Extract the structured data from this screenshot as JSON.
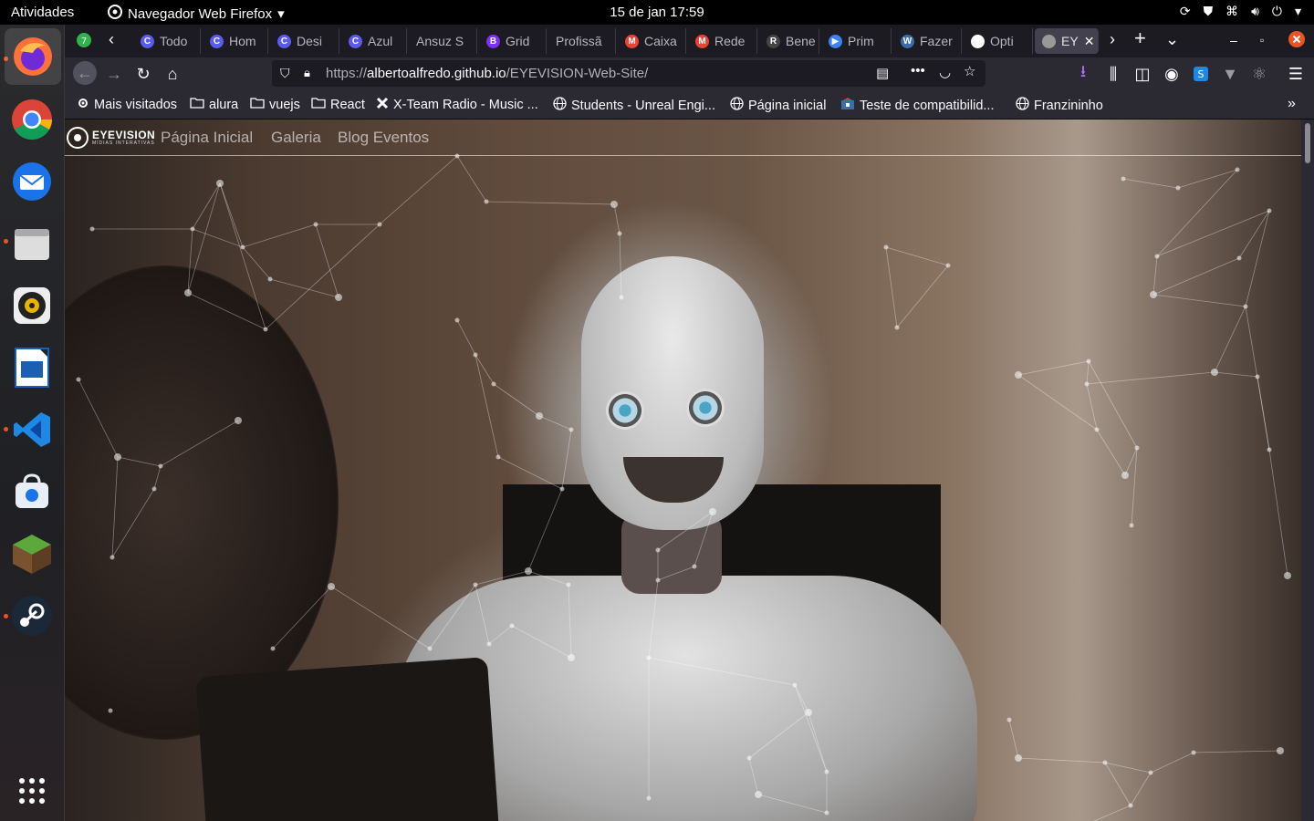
{
  "topbar": {
    "activities": "Atividades",
    "app_name": "Navegador Web Firefox",
    "clock": "15 de jan  17:59"
  },
  "dock": {
    "items": [
      "firefox-icon",
      "chrome-icon",
      "thunderbird-icon",
      "files-icon",
      "rhythmbox-icon",
      "writer-icon",
      "vscode-icon",
      "software-icon",
      "minecraft-icon",
      "steam-icon",
      "app-grid-icon"
    ]
  },
  "tabs": [
    {
      "label": "Todo",
      "favicon": "C",
      "color": "#5b5bf0"
    },
    {
      "label": "Hom",
      "favicon": "C",
      "color": "#5b5bf0"
    },
    {
      "label": "Desi",
      "favicon": "C",
      "color": "#5b5bf0"
    },
    {
      "label": "Azul",
      "favicon": "C",
      "color": "#5b5bf0"
    },
    {
      "label": "Ansuz S",
      "favicon": "",
      "color": ""
    },
    {
      "label": "Grid",
      "favicon": "B",
      "color": "#7b2ff7"
    },
    {
      "label": "Profissã",
      "favicon": "",
      "color": ""
    },
    {
      "label": "Caixa",
      "favicon": "M",
      "color": "#ea4335"
    },
    {
      "label": "Rede",
      "favicon": "M",
      "color": "#ea4335"
    },
    {
      "label": "Bene",
      "favicon": "R",
      "color": "#444"
    },
    {
      "label": "Prim",
      "favicon": "▶",
      "color": "#3b82f6"
    },
    {
      "label": "Fazer",
      "favicon": "W",
      "color": "#3b6ea8"
    },
    {
      "label": "Opti",
      "favicon": "",
      "color": "#fff"
    },
    {
      "label": "EY",
      "favicon": "",
      "color": "#999"
    }
  ],
  "urlbar": {
    "scheme": "https://",
    "host": "albertoalfredo.github.io",
    "path": "/EYEVISION-Web-Site/"
  },
  "bookmarks": [
    {
      "label": "Mais visitados",
      "icon": "gear-icon"
    },
    {
      "label": "alura",
      "icon": "folder-icon"
    },
    {
      "label": "vuejs",
      "icon": "folder-icon"
    },
    {
      "label": "React",
      "icon": "folder-icon"
    },
    {
      "label": "X-Team Radio - Music ...",
      "icon": "xteam-icon"
    },
    {
      "label": "Students - Unreal Engi...",
      "icon": "globe-icon"
    },
    {
      "label": "Página inicial",
      "icon": "globe-icon"
    },
    {
      "label": "Teste de compatibilid...",
      "icon": "compat-icon"
    },
    {
      "label": "Franzininho",
      "icon": "globe-icon"
    }
  ],
  "site": {
    "logo_name": "EYEVISION",
    "logo_tag": "MÍDIAS INTERATIVAS",
    "nav": [
      "Página Inicial",
      "Galeria",
      "Blog Eventos"
    ]
  },
  "colors": {
    "accent": "#e95420",
    "browser_bg": "#1c1b22",
    "toolbar_bg": "#2b2a33"
  }
}
